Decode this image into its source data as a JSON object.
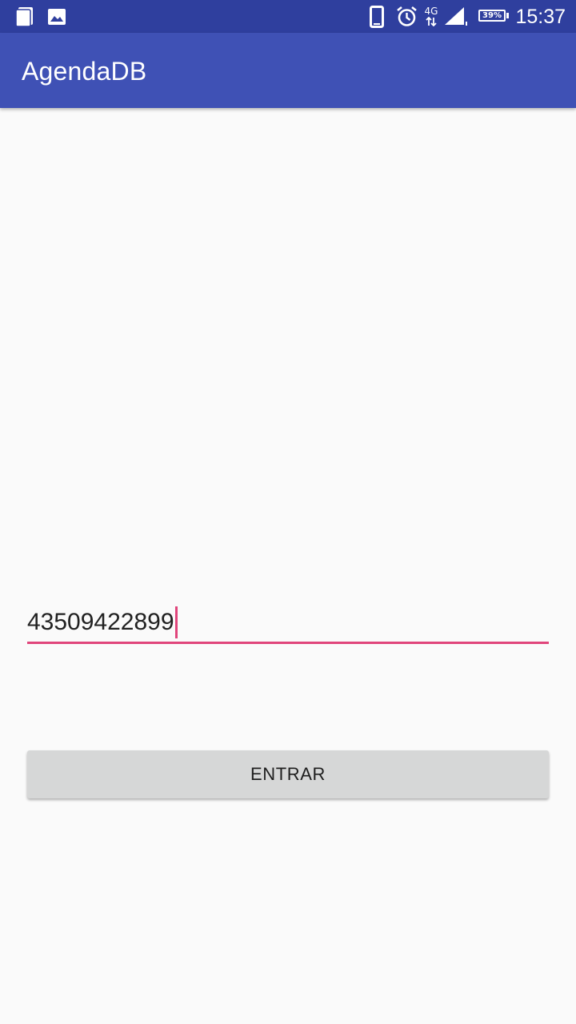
{
  "status_bar": {
    "time": "15:37",
    "battery_percent": "39%",
    "network": "4G",
    "left_icons": [
      "notes-icon",
      "image-icon"
    ],
    "right_icons": [
      "phone-icon",
      "alarm-icon",
      "network-4g-icon",
      "signal-icon",
      "battery-icon"
    ]
  },
  "app_bar": {
    "title": "AgendaDB"
  },
  "form": {
    "phone_value": "43509422899",
    "submit_label": "ENTRAR"
  },
  "colors": {
    "status_bar": "#2f3f9e",
    "app_bar": "#3f51b5",
    "accent": "#e0457b",
    "button": "#d6d7d7",
    "background": "#fafafa"
  }
}
